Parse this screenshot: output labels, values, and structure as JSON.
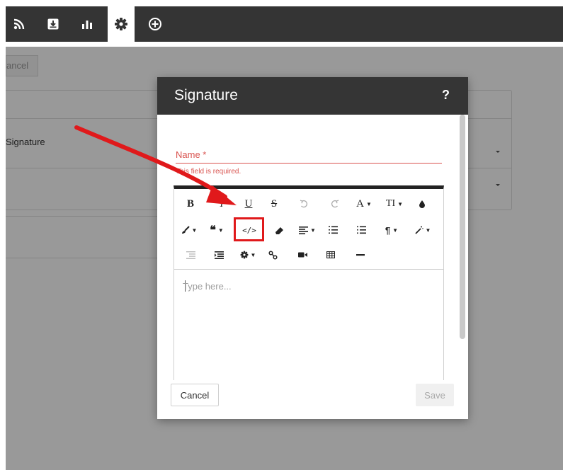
{
  "topbar": {
    "buttons": [
      {
        "icon": "rss-icon"
      },
      {
        "icon": "download-box-icon"
      },
      {
        "icon": "bar-chart-icon"
      },
      {
        "icon": "gear-icon",
        "active": true
      },
      {
        "icon": "plus-circle-icon"
      }
    ]
  },
  "background": {
    "cancel_label": "ancel",
    "signature_label": "Signature"
  },
  "dialog": {
    "title": "Signature",
    "help": "?",
    "name_label": "Name *",
    "error_text": "This field is required.",
    "placeholder": "Type here...",
    "cancel_label": "Cancel",
    "save_label": "Save",
    "toolbar": {
      "row1": [
        "B",
        "I",
        "U",
        "S",
        "undo",
        "redo",
        "A▾",
        "TI▾",
        "color"
      ],
      "row2": [
        "brush▾",
        "quote▾",
        "</>",
        "eraser",
        "align▾",
        "ol",
        "ul",
        "¶▾",
        "magic▾"
      ],
      "row3": [
        "outdent",
        "indent",
        "settings▾",
        "link",
        "video",
        "table",
        "hr"
      ],
      "code_label": "</>",
      "bold": "B",
      "italic": "I",
      "underline": "U",
      "strike": "S",
      "font_color": "A",
      "text_size": "TI",
      "paragraph": "¶"
    }
  },
  "colors": {
    "header": "#353535",
    "error": "#d9534f",
    "annotation": "#e0191b"
  }
}
